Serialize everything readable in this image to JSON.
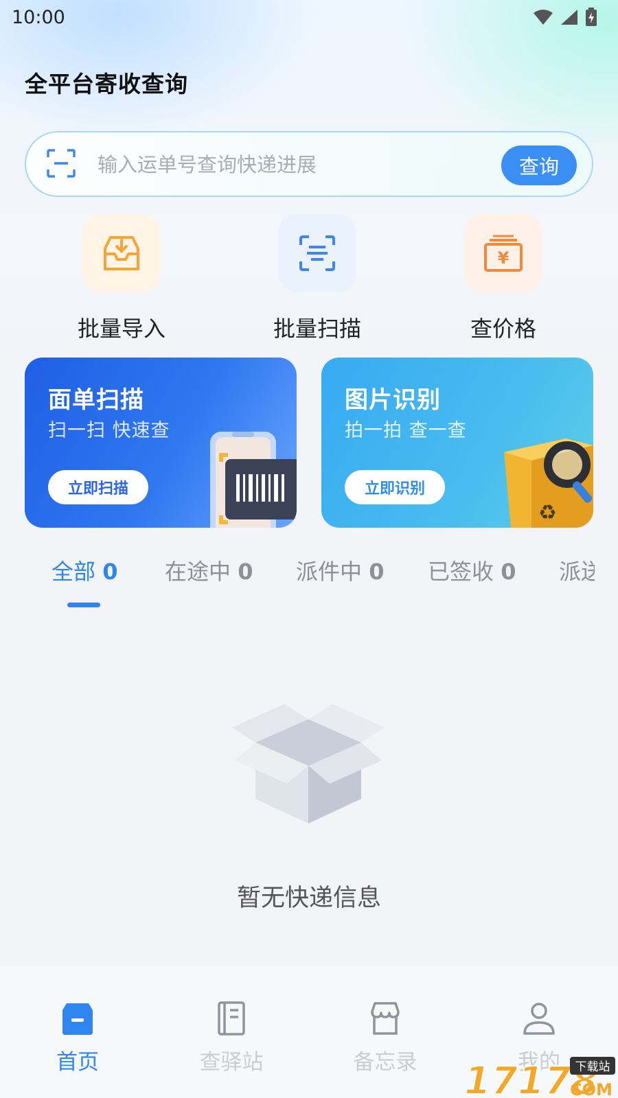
{
  "status_bar": {
    "time": "10:00"
  },
  "header": {
    "title": "全平台寄收查询"
  },
  "search": {
    "placeholder": "输入运单号查询快递进展",
    "button_label": "查询"
  },
  "quick_actions": [
    {
      "label": "批量导入",
      "icon": "inbox-download-icon"
    },
    {
      "label": "批量扫描",
      "icon": "scan-icon"
    },
    {
      "label": "查价格",
      "icon": "price-yuan-icon"
    }
  ],
  "banners": [
    {
      "title": "面单扫描",
      "subtitle": "扫一扫 快速查",
      "button_label": "立即扫描",
      "art": "phone-barcode-illustration"
    },
    {
      "title": "图片识别",
      "subtitle": "拍一拍 查一查",
      "button_label": "立即识别",
      "art": "package-magnifier-illustration"
    }
  ],
  "tabs": [
    {
      "label": "全部",
      "count": "0",
      "active": true
    },
    {
      "label": "在途中",
      "count": "0"
    },
    {
      "label": "派件中",
      "count": "0"
    },
    {
      "label": "已签收",
      "count": "0"
    },
    {
      "label": "派送",
      "count": ""
    }
  ],
  "empty_state": {
    "message": "暂无快递信息",
    "icon": "open-box-icon"
  },
  "bottom_nav": [
    {
      "label": "首页",
      "icon": "home-box-icon",
      "active": true
    },
    {
      "label": "查驿站",
      "icon": "notebook-icon"
    },
    {
      "label": "备忘录",
      "icon": "store-icon"
    },
    {
      "label": "我的",
      "icon": "user-icon"
    }
  ],
  "watermark": {
    "text": "17178",
    "suffix": "COM",
    "tag": "下载站"
  },
  "colors": {
    "accent": "#2f86f0",
    "search_button": "#3a8ff4",
    "banner_blue": "#2f78f0",
    "banner_cyan": "#49bcef"
  }
}
